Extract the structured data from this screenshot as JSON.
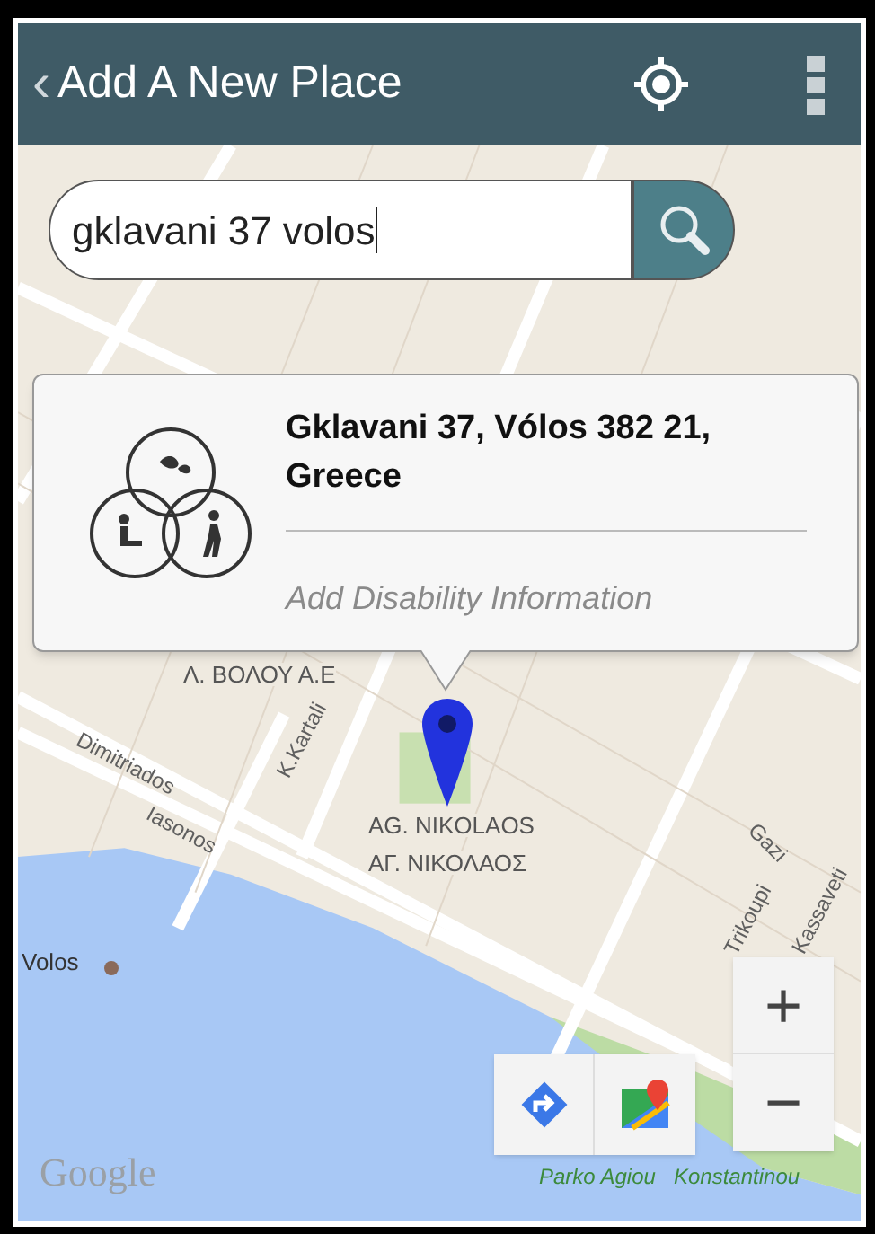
{
  "header": {
    "back": "‹",
    "title": "Add A New Place"
  },
  "search": {
    "value": "gklavani 37 volos"
  },
  "place_card": {
    "address": "Gklavani 37, Vólos 382 21, Greece",
    "action": "Add Disability Information"
  },
  "map_labels": [
    {
      "kind": "area",
      "text": "Λ. ΒΟΛΟΥ Α.Ε"
    },
    {
      "kind": "street",
      "text": "Dimitriados"
    },
    {
      "kind": "street",
      "text": "K.Kartali"
    },
    {
      "kind": "street",
      "text": "Iasonos"
    },
    {
      "kind": "area",
      "text": "AG. NIKOLAOS"
    },
    {
      "kind": "area",
      "text": "ΑΓ. ΝΙΚΟΛΑΟΣ"
    },
    {
      "kind": "street",
      "text": "Gazi"
    },
    {
      "kind": "street",
      "text": "Trikoupi"
    },
    {
      "kind": "street",
      "text": "Kassaveti"
    },
    {
      "kind": "place",
      "text": "Volos"
    },
    {
      "kind": "park",
      "text": "Parko Agiou"
    },
    {
      "kind": "park",
      "text": "Konstantinou"
    }
  ],
  "zoom": {
    "in": "+",
    "out": "−"
  },
  "attribution": "Google"
}
